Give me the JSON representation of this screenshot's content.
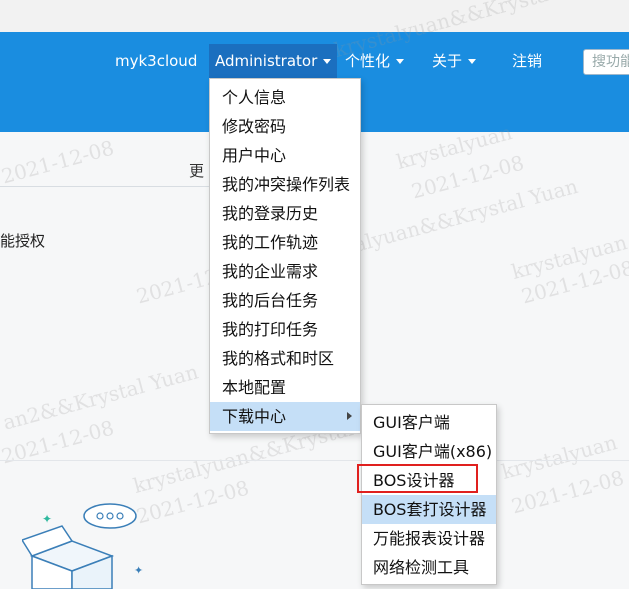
{
  "header": {
    "nav": {
      "user": "myk3cloud",
      "admin": "Administrator",
      "personalize": "个性化",
      "about": "关于",
      "logout": "注销"
    },
    "search_text": "搜功能"
  },
  "background": {
    "more_text": "更",
    "left_text": "能授权",
    "watermarks": [
      "2021-12-08",
      "krystalyuan&&Krystal Yuan",
      "2021-12-08",
      "krystalyuan&&Krystal Yuan",
      "2021-12-08",
      "krystalyuan",
      "2021-12-08",
      "2021-12-08",
      "an2&&Krystal Yuan",
      "krystalyuan&&Krystal",
      "2021-12-08",
      "2021-12-08",
      "krystalyuan"
    ]
  },
  "menu": {
    "items": [
      "个人信息",
      "修改密码",
      "用户中心",
      "我的冲突操作列表",
      "我的登录历史",
      "我的工作轨迹",
      "我的企业需求",
      "我的后台任务",
      "我的打印任务",
      "我的格式和时区",
      "本地配置",
      "下载中心"
    ]
  },
  "submenu": {
    "items": [
      "GUI客户端",
      "GUI客户端(x86)",
      "BOS设计器",
      "BOS套打设计器",
      "万能报表设计器",
      "网络检测工具"
    ]
  },
  "colors": {
    "header_bg": "#1a8de0",
    "admin_bg": "#1b6fbf",
    "menu_hover": "#c5dff7",
    "highlight_border": "#e0201e"
  }
}
